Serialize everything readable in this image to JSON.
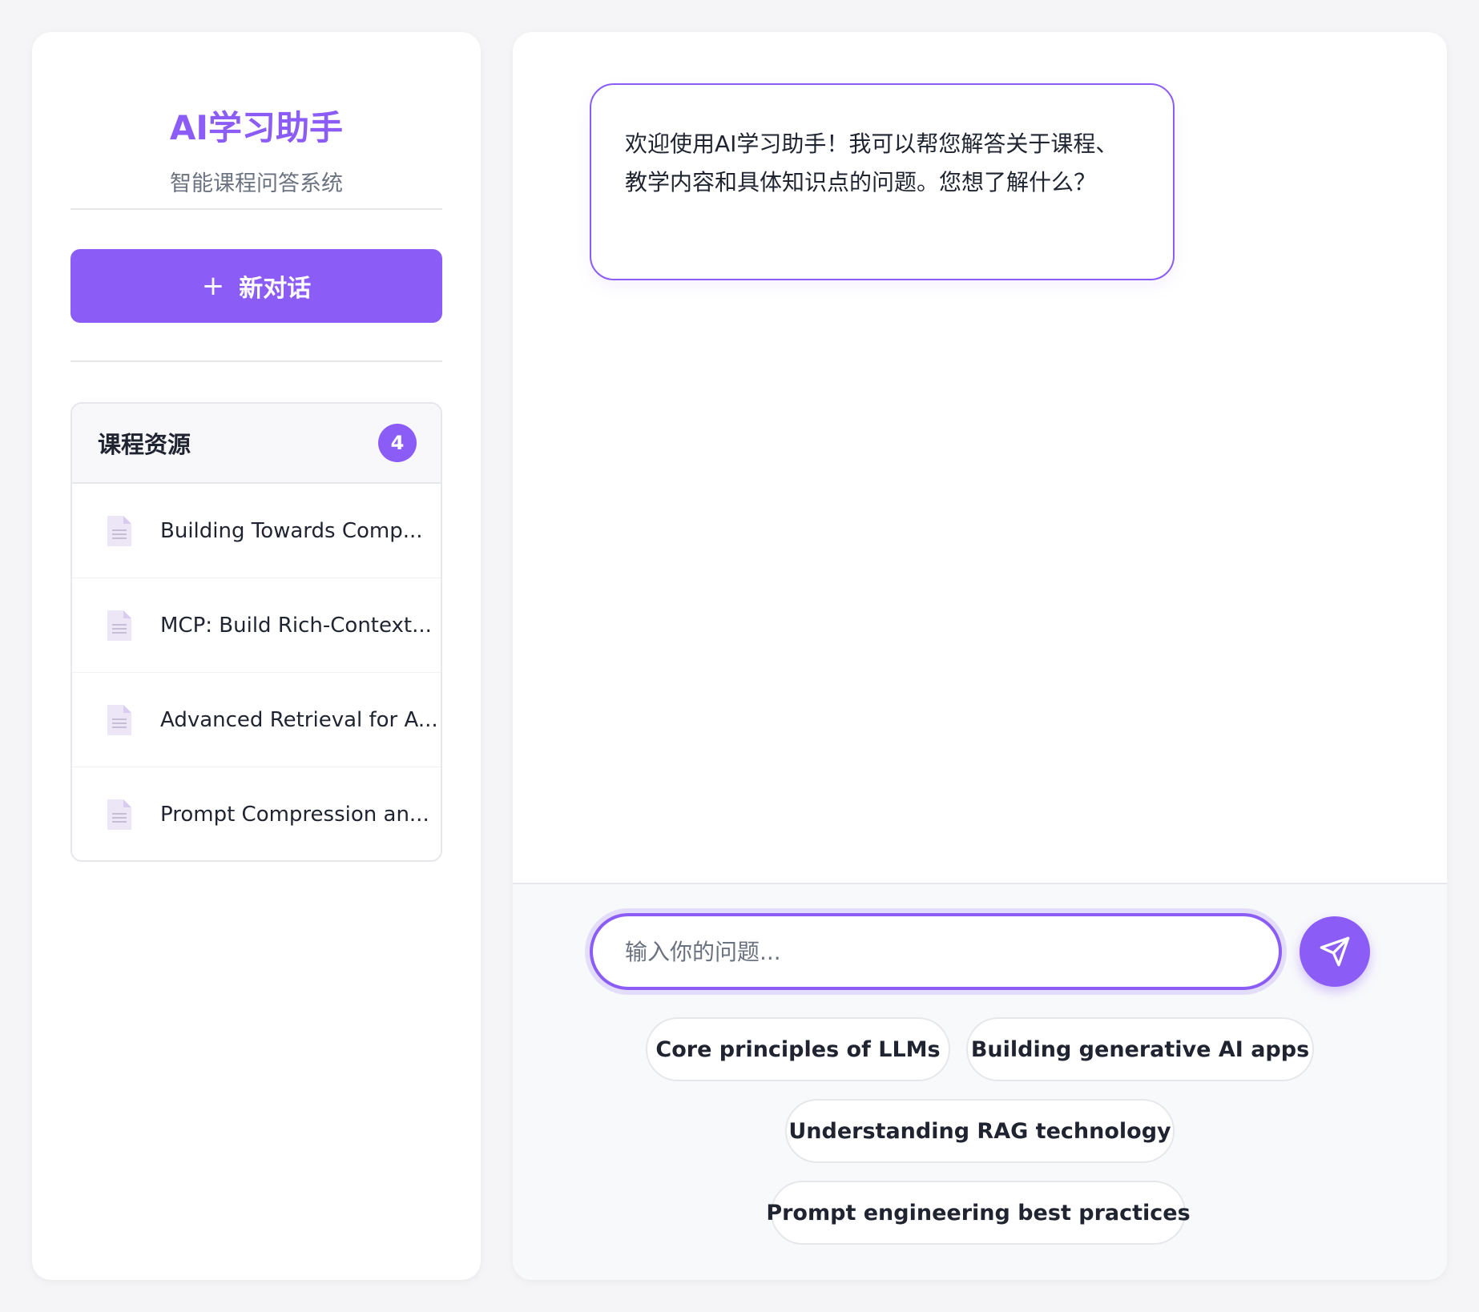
{
  "sidebar": {
    "title": "AI学习助手",
    "subtitle": "智能课程问答系统",
    "new_chat": {
      "icon": "plus-icon",
      "label": "新对话"
    },
    "resources": {
      "title": "课程资源",
      "count": "4",
      "items": [
        {
          "icon": "document-icon",
          "label": "Building Towards Comp..."
        },
        {
          "icon": "document-icon",
          "label": "MCP: Build Rich-Context..."
        },
        {
          "icon": "document-icon",
          "label": "Advanced Retrieval for A..."
        },
        {
          "icon": "document-icon",
          "label": "Prompt Compression an..."
        }
      ]
    }
  },
  "chat": {
    "welcome_message": "欢迎使用AI学习助手！我可以帮您解答关于课程、教学内容和具体知识点的问题。您想了解什么？",
    "input": {
      "placeholder": "输入你的问题...",
      "value": ""
    },
    "send_icon": "send-icon",
    "suggestions": [
      "Core principles of LLMs",
      "Building generative AI apps",
      "Understanding RAG technology",
      "Prompt engineering best practices"
    ]
  },
  "colors": {
    "accent": "#8b5cf6",
    "background": "#f5f5f7",
    "text": "#1f2430",
    "muted": "#6b7280"
  }
}
